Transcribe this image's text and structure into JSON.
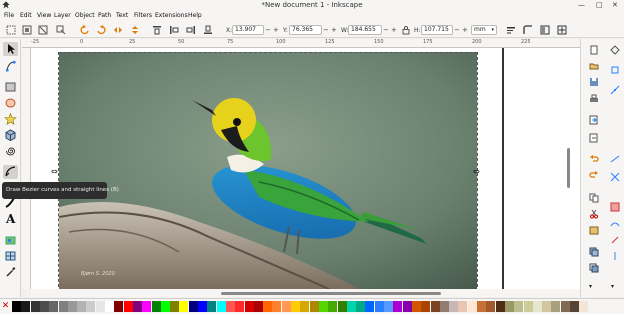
{
  "window": {
    "title": "*New document 1 - Inkscape",
    "minimize": "—",
    "maximize": "□",
    "close": "✕"
  },
  "menu": [
    "File",
    "Edit",
    "View",
    "Layer",
    "Object",
    "Path",
    "Text",
    "Filters",
    "Extensions",
    "Help"
  ],
  "toolbar": {
    "x_label": "X:",
    "x_value": "13.907",
    "y_label": "Y:",
    "y_value": "76.365",
    "w_label": "W:",
    "w_value": "184.655",
    "h_label": "H:",
    "h_value": "107.715",
    "unit": "mm",
    "plus": "+",
    "minus": "−"
  },
  "ruler": {
    "top_ticks": [
      "-25",
      "0",
      "25",
      "50",
      "75",
      "100",
      "125",
      "150",
      "175",
      "200",
      "225"
    ]
  },
  "tooltip": "Draw Bezier curves and straight lines (B)",
  "photo_caption": "Bjørn S. 2020",
  "tools": [
    "selector-tool",
    "node-tool",
    "rect-tool",
    "ellipse-tool",
    "star-tool",
    "3d-box-tool",
    "spiral-tool",
    "bezier-tool",
    "calligraphy-tool",
    "text-tool",
    "spray-tool",
    "zoom-tool",
    "dropper-tool"
  ],
  "palette_colors": [
    "#000000",
    "#1a1a1a",
    "#333333",
    "#4d4d4d",
    "#666666",
    "#808080",
    "#999999",
    "#b3b3b3",
    "#cccccc",
    "#e6e6e6",
    "#ffffff",
    "#800000",
    "#ff0000",
    "#800080",
    "#ff00ff",
    "#008000",
    "#00ff00",
    "#808000",
    "#ffff00",
    "#000080",
    "#0000ff",
    "#008080",
    "#00ffff",
    "#ff5555",
    "#ff2a2a",
    "#d40000",
    "#aa0000",
    "#ff6600",
    "#ff7f2a",
    "#ff9955",
    "#ffcc00",
    "#d4aa00",
    "#aa8800",
    "#55d400",
    "#44aa00",
    "#338000",
    "#00d4aa",
    "#00aa88",
    "#0066ff",
    "#2a7fff",
    "#5599ff",
    "#aa00d4",
    "#8800aa",
    "#d45500",
    "#aa4400",
    "#784421",
    "#917c6f",
    "#c8b7b7",
    "#e9c6af",
    "#ffe6d5",
    "#c87137",
    "#a05a2c",
    "#502d16",
    "#999966",
    "#bcbc8c",
    "#cccc99",
    "#e6e6cc",
    "#d4c5a1",
    "#aa9f7c",
    "#806b50",
    "#554433",
    "#f4e3d7"
  ]
}
